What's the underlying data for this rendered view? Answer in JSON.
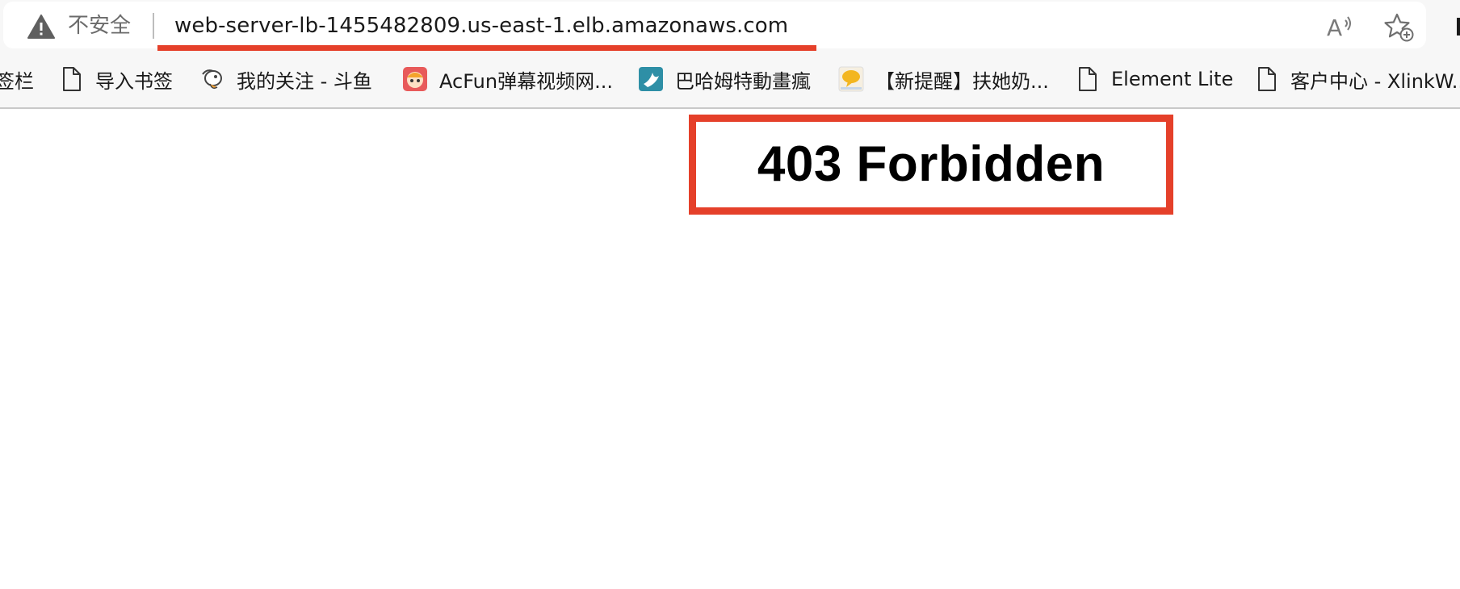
{
  "address_bar": {
    "security_label": "不安全",
    "url": "web-server-lb-1455482809.us-east-1.elb.amazonaws.com"
  },
  "bookmarks": [
    {
      "label": "签栏",
      "icon": "none"
    },
    {
      "label": "导入书签",
      "icon": "page-icon"
    },
    {
      "label": "我的关注 - 斗鱼",
      "icon": "douyu-icon"
    },
    {
      "label": "AcFun弹幕视频网...",
      "icon": "acfun-icon"
    },
    {
      "label": "巴哈姆特動畫瘋",
      "icon": "bahamut-icon"
    },
    {
      "label": "【新提醒】扶她奶...",
      "icon": "yellow-bubble-icon"
    },
    {
      "label": "Element Lite",
      "icon": "page-icon"
    },
    {
      "label": "客户中心 - XlinkW...",
      "icon": "page-icon"
    }
  ],
  "page": {
    "title": "403 Forbidden"
  },
  "colors": {
    "annotation_red": "#e5402a",
    "chrome_bg": "#f7f7f7"
  }
}
